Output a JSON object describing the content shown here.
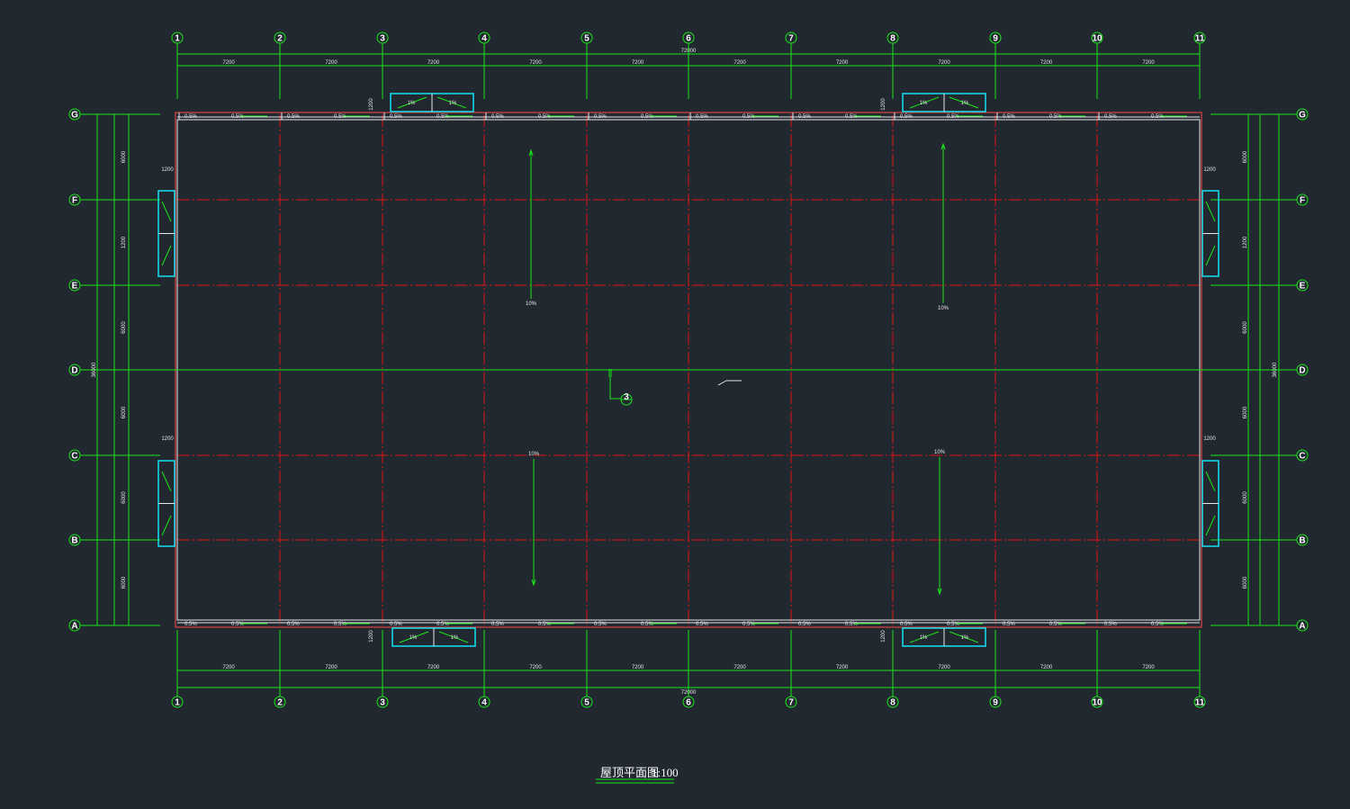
{
  "drawing": {
    "title": "屋顶平面图",
    "scale": "1:100",
    "colors": {
      "background": "#212830",
      "dimension": "#19e619",
      "grid_line": "#e01414",
      "boundary": "#ff4a4a",
      "hatch": "#17d6e6",
      "text": "#e8e8e8"
    }
  },
  "grid_x": {
    "labels": [
      "1",
      "2",
      "3",
      "4",
      "5",
      "6",
      "7",
      "8",
      "9",
      "10",
      "11"
    ],
    "spacings": [
      "7200",
      "7200",
      "7200",
      "7200",
      "7200",
      "7200",
      "7200",
      "7200",
      "7200",
      "7200"
    ],
    "total": "72000"
  },
  "grid_y": {
    "labels": [
      "G",
      "F",
      "E",
      "D",
      "C",
      "B",
      "A"
    ],
    "spacings_left": [
      "6000",
      "1200",
      "6000",
      "6000",
      "6000",
      "6000"
    ],
    "spacings_right": [
      "6000",
      "1200",
      "6000",
      "6000",
      "6000",
      "6000"
    ],
    "total": "36000"
  },
  "slopes": {
    "gutter": "0.5%",
    "roof": "10%",
    "drain": "1%"
  },
  "hatch_dims": {
    "top": "1200",
    "side": "1200"
  },
  "section_marker": "3"
}
